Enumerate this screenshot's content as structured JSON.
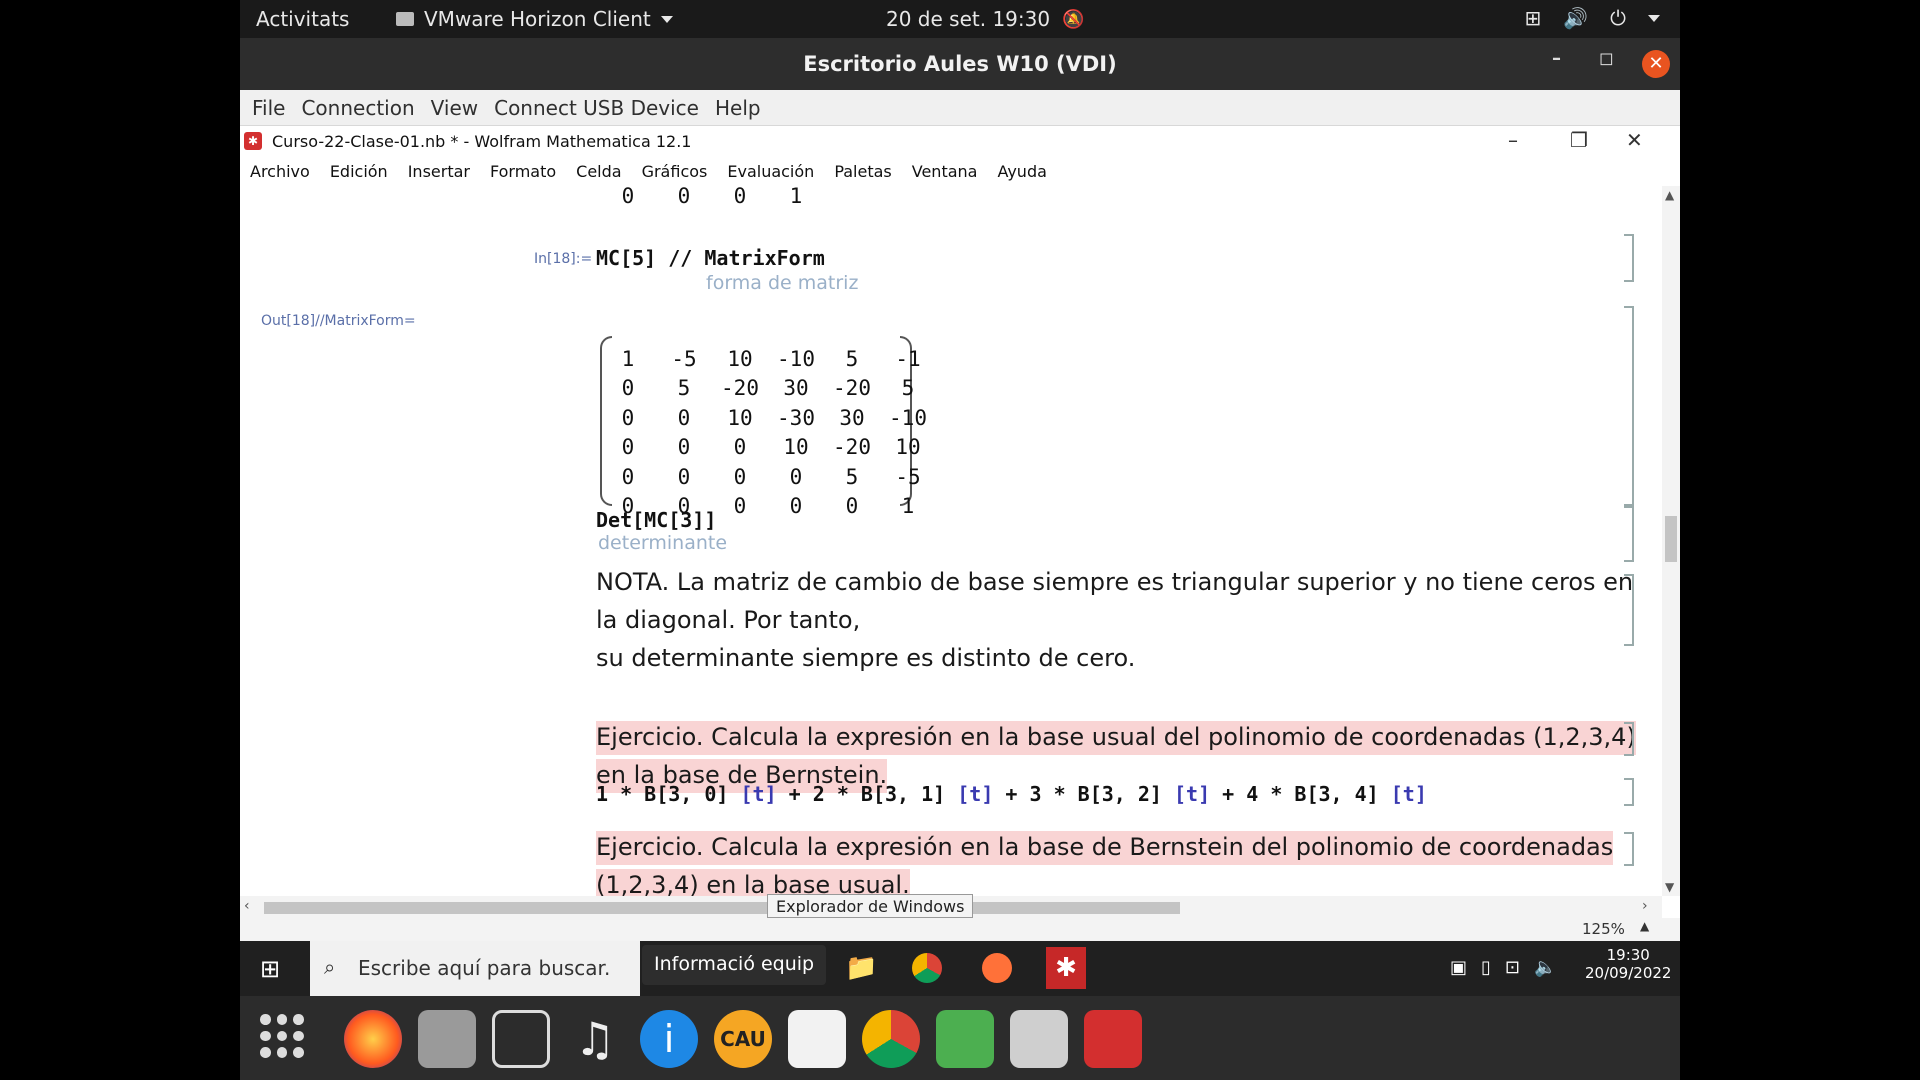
{
  "gnome": {
    "activities": "Activitats",
    "app": "VMware Horizon Client",
    "clock": "20 de set.  19:30"
  },
  "horizon": {
    "title": "Escritorio Aules W10 (VDI)",
    "menu": [
      "File",
      "Connection",
      "View",
      "Connect USB Device",
      "Help"
    ]
  },
  "mathematica": {
    "title": "Curso-22-Clase-01.nb * - Wolfram Mathematica 12.1",
    "menu": [
      "Archivo",
      "Edición",
      "Insertar",
      "Formato",
      "Celda",
      "Gráficos",
      "Evaluación",
      "Paletas",
      "Ventana",
      "Ayuda"
    ],
    "top_partial_row": [
      "0",
      "0",
      "0",
      "1"
    ],
    "in18_label": "In[18]:=",
    "in18_code": "MC[5] // MatrixForm",
    "in18_hint": "forma de matriz",
    "out18_label": "Out[18]//MatrixForm=",
    "matrix": [
      [
        "1",
        "-5",
        "10",
        "-10",
        "5",
        "-1"
      ],
      [
        "0",
        "5",
        "-20",
        "30",
        "-20",
        "5"
      ],
      [
        "0",
        "0",
        "10",
        "-30",
        "30",
        "-10"
      ],
      [
        "0",
        "0",
        "0",
        "10",
        "-20",
        "10"
      ],
      [
        "0",
        "0",
        "0",
        "0",
        "5",
        "-5"
      ],
      [
        "0",
        "0",
        "0",
        "0",
        "0",
        "1"
      ]
    ],
    "det_code": "Det[MC[3]]",
    "det_hint": "determinante",
    "nota_line1": "NOTA. La matriz de cambio de base siempre es triangular superior y no tiene ceros en la diagonal. Por tanto,",
    "nota_line2": "su determinante siempre es distinto de cero.",
    "ej1": "Ejercicio.  Calcula la expresión en la base usual del polinomio de coordenadas (1,2,3,4) en la base de Bernstein.",
    "code_line": [
      "1 * B[3, 0] ",
      "[t]",
      " + 2 * B[3, 1] ",
      "[t]",
      " + 3 * B[3, 2] ",
      "[t]",
      " + 4 * B[3, 4] ",
      "[t]"
    ],
    "ej2": "Ejercicio.  Calcula la expresión en la base de Bernstein del polinomio de coordenadas (1,2,3,4) en la base usual.",
    "zoom": "125%",
    "tooltip": "Explorador de Windows"
  },
  "windows_taskbar": {
    "search_placeholder": "Escribe aquí para buscar.",
    "popup": "Informació equip",
    "time": "19:30",
    "date": "20/09/2022"
  },
  "dock": {
    "items": [
      "apps-grid-icon",
      "firefox-icon",
      "camera-icon",
      "remote-desktop-icon",
      "music-icon",
      "info-icon",
      "cau-icon",
      "board-icon",
      "chrome-icon",
      "cloud-icon",
      "files-icon",
      "reader-icon"
    ]
  }
}
